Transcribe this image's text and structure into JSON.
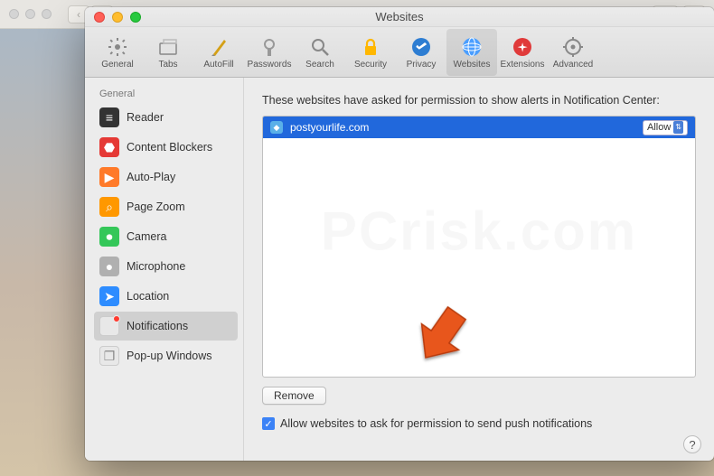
{
  "window": {
    "title": "Websites"
  },
  "toolbar": [
    {
      "label": "General",
      "name": "general"
    },
    {
      "label": "Tabs",
      "name": "tabs"
    },
    {
      "label": "AutoFill",
      "name": "autofill"
    },
    {
      "label": "Passwords",
      "name": "passwords"
    },
    {
      "label": "Search",
      "name": "search"
    },
    {
      "label": "Security",
      "name": "security"
    },
    {
      "label": "Privacy",
      "name": "privacy"
    },
    {
      "label": "Websites",
      "name": "websites",
      "selected": true
    },
    {
      "label": "Extensions",
      "name": "extensions"
    },
    {
      "label": "Advanced",
      "name": "advanced"
    }
  ],
  "sidebar": {
    "header": "General",
    "items": [
      {
        "label": "Reader",
        "name": "reader",
        "color": "#333333",
        "glyph": "≡"
      },
      {
        "label": "Content Blockers",
        "name": "content-blockers",
        "color": "#e53935",
        "glyph": "⬣"
      },
      {
        "label": "Auto-Play",
        "name": "auto-play",
        "color": "#ff7a29",
        "glyph": "▶"
      },
      {
        "label": "Page Zoom",
        "name": "page-zoom",
        "color": "#ff9800",
        "glyph": "⌕"
      },
      {
        "label": "Camera",
        "name": "camera",
        "color": "#34c759",
        "glyph": "⏺"
      },
      {
        "label": "Microphone",
        "name": "microphone",
        "color": "#b0b0b0",
        "glyph": "●"
      },
      {
        "label": "Location",
        "name": "location",
        "color": "#2d8cff",
        "glyph": "➤"
      },
      {
        "label": "Notifications",
        "name": "notifications",
        "color": "#e8e8e8",
        "glyph": "",
        "selected": true,
        "badge": true
      },
      {
        "label": "Pop-up Windows",
        "name": "popup-windows",
        "color": "#e8e8e8",
        "glyph": "❐"
      }
    ]
  },
  "main": {
    "description": "These websites have asked for permission to show alerts in Notification Center:",
    "sites": [
      {
        "domain": "postyourlife.com",
        "permission": "Allow"
      }
    ],
    "remove_label": "Remove",
    "checkbox_label": "Allow websites to ask for permission to send push notifications",
    "checkbox_checked": true,
    "help_label": "?"
  }
}
